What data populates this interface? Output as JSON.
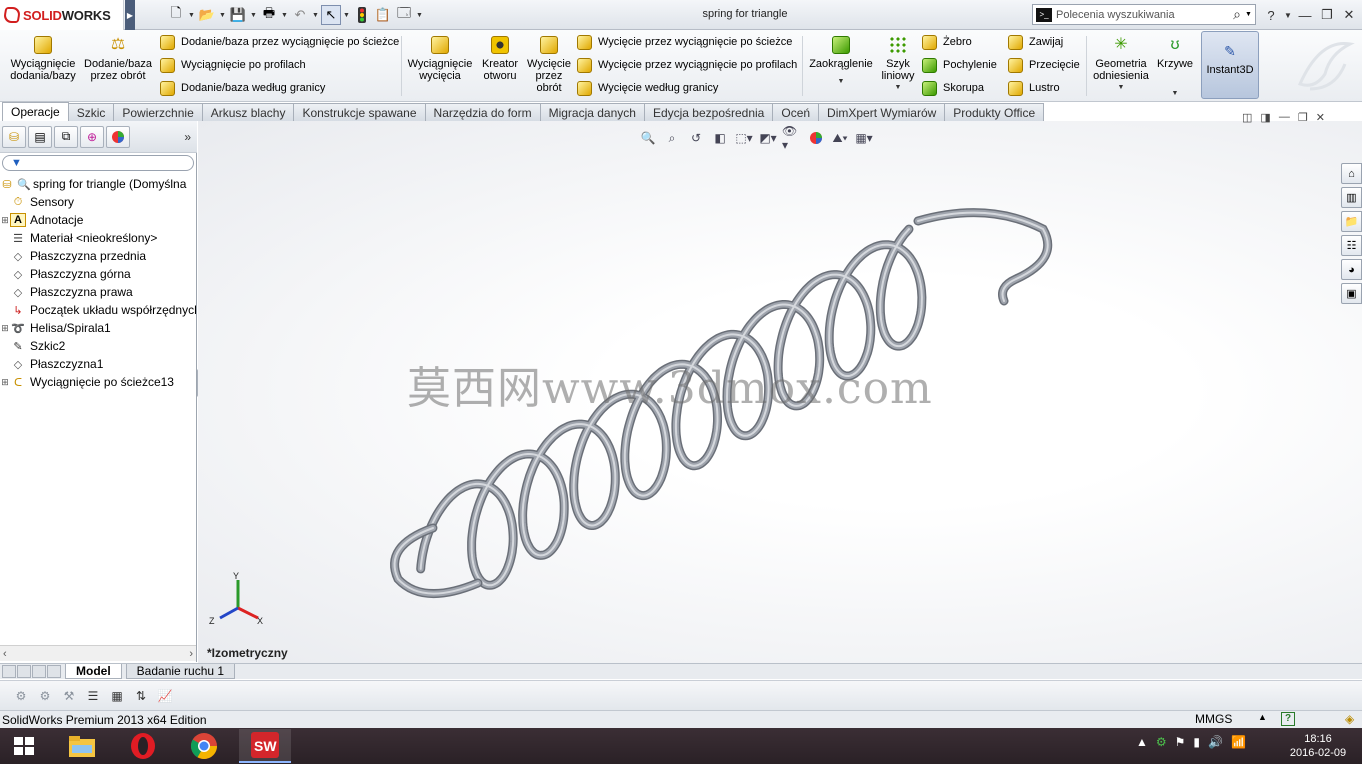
{
  "app": {
    "brand": "SOLIDWORKS",
    "brand_prefix": "SOLID",
    "brand_suffix": "WORKS",
    "document_title": "spring for triangle"
  },
  "search": {
    "placeholder": "Polecenia wyszukiwania"
  },
  "ribbon": {
    "group1_big": [
      {
        "label": "Wyciągnięcie\ndodania/bazy"
      },
      {
        "label": "Dodanie/baza\nprzez obrót"
      }
    ],
    "group1_small": [
      "Dodanie/baza przez wyciągnięcie po ścieżce",
      "Wyciągnięcie po profilach",
      "Dodanie/baza według granicy"
    ],
    "group2_big": [
      {
        "label": "Wyciągnięcie\nwycięcia"
      },
      {
        "label": "Kreator\notworu"
      },
      {
        "label": "Wycięcie\nprzez\nobrót"
      }
    ],
    "group2_small": [
      "Wycięcie przez wyciągnięcie po ścieżce",
      "Wycięcie przez wyciągnięcie po profilach",
      "Wycięcie według granicy"
    ],
    "fillet": "Zaokrąglenie",
    "linear_pattern": "Szyk\nliniowy",
    "group3_small": [
      "Żebro",
      "Pochylenie",
      "Skorupa"
    ],
    "group4_small": [
      "Zawijaj",
      "Przecięcie",
      "Lustro"
    ],
    "ref_geometry": "Geometria\nodniesienia",
    "curves": "Krzywe",
    "instant3d": "Instant3D"
  },
  "tabs": [
    {
      "label": "Operacje",
      "active": true
    },
    {
      "label": "Szkic"
    },
    {
      "label": "Powierzchnie"
    },
    {
      "label": "Arkusz blachy"
    },
    {
      "label": "Konstrukcje spawane"
    },
    {
      "label": "Narzędzia do form"
    },
    {
      "label": "Migracja danych"
    },
    {
      "label": "Edycja bezpośrednia"
    },
    {
      "label": "Oceń"
    },
    {
      "label": "DimXpert Wymiarów"
    },
    {
      "label": "Produkty Office"
    }
  ],
  "feature_tree": {
    "root": "spring for triangle  (Domyślna",
    "items": [
      {
        "label": "Sensory",
        "icon": "sensor-icon",
        "expand": ""
      },
      {
        "label": "Adnotacje",
        "icon": "annotation-icon",
        "expand": "+"
      },
      {
        "label": "Materiał <nieokreślony>",
        "icon": "material-icon",
        "expand": ""
      },
      {
        "label": "Płaszczyzna przednia",
        "icon": "plane-icon",
        "expand": ""
      },
      {
        "label": "Płaszczyzna górna",
        "icon": "plane-icon",
        "expand": ""
      },
      {
        "label": "Płaszczyzna prawa",
        "icon": "plane-icon",
        "expand": ""
      },
      {
        "label": "Początek układu współrzędnych",
        "icon": "origin-icon",
        "expand": ""
      },
      {
        "label": "Helisa/Spirala1",
        "icon": "helix-icon",
        "expand": "+"
      },
      {
        "label": "Szkic2",
        "icon": "sketch-icon",
        "expand": ""
      },
      {
        "label": "Płaszczyzna1",
        "icon": "plane-icon",
        "expand": ""
      },
      {
        "label": "Wyciągnięcie po ścieżce13",
        "icon": "sweep-icon",
        "expand": "+"
      }
    ]
  },
  "graphics": {
    "watermark": "莫西网www.3dmox.com",
    "view_label": "*Izometryczny",
    "triad": {
      "x": "X",
      "y": "Y",
      "z": "Z"
    }
  },
  "bottom_tabs": [
    {
      "label": "Model",
      "active": true
    },
    {
      "label": "Badanie ruchu 1"
    }
  ],
  "status": {
    "edition": "SolidWorks Premium 2013 x64 Edition",
    "units": "MMGS"
  },
  "clock": {
    "time": "18:16",
    "date": "2016-02-09"
  },
  "colors": {
    "accent_red": "#d21f1f",
    "spring": "#6a6f78",
    "taskbar": "#2e2429"
  }
}
